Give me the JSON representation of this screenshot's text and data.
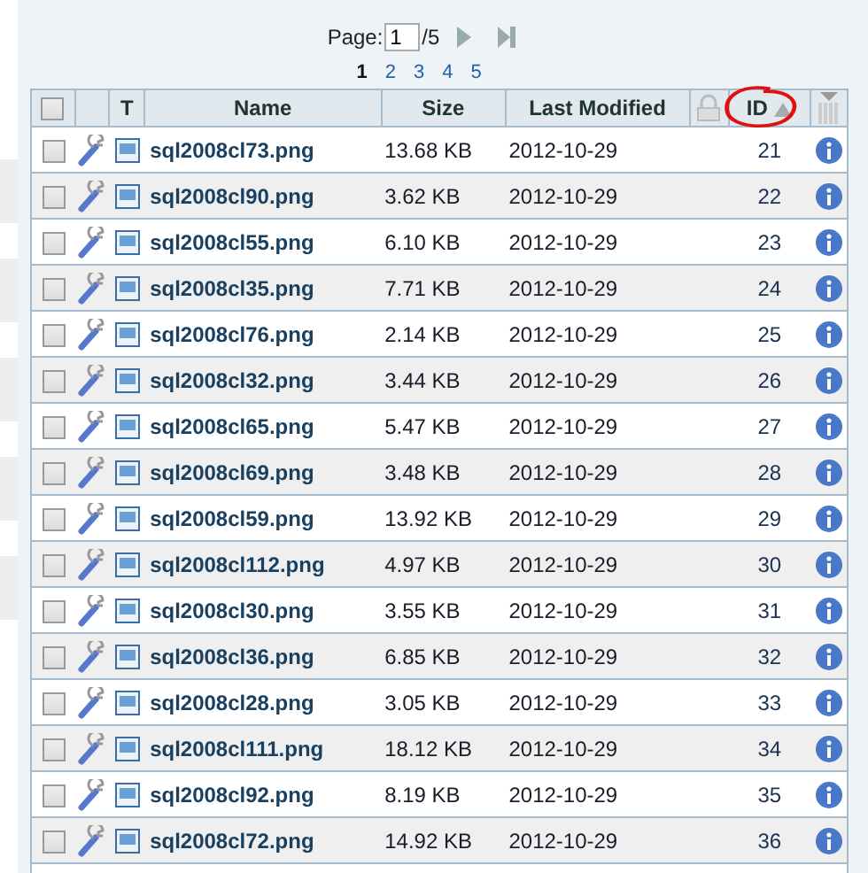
{
  "pager": {
    "label": "Page:",
    "value": "1",
    "total": "/5",
    "pages": [
      {
        "label": "1",
        "selected": true
      },
      {
        "label": "2",
        "selected": false
      },
      {
        "label": "3",
        "selected": false
      },
      {
        "label": "4",
        "selected": false
      },
      {
        "label": "5",
        "selected": false
      }
    ]
  },
  "table": {
    "select_all_checked": false,
    "columns": [
      {
        "label": "T",
        "sorted": false
      },
      {
        "label": "Name",
        "sorted": false
      },
      {
        "label": "Size",
        "sorted": false
      },
      {
        "label": "Last Modified",
        "sorted": false
      },
      {
        "label": "ID",
        "sorted": true
      }
    ],
    "rows": [
      {
        "name": "sql2008cl73.png",
        "size": "13.68 KB",
        "modified": "2012-10-29",
        "id": "21",
        "checked": false
      },
      {
        "name": "sql2008cl90.png",
        "size": "3.62 KB",
        "modified": "2012-10-29",
        "id": "22",
        "checked": false
      },
      {
        "name": "sql2008cl55.png",
        "size": "6.10 KB",
        "modified": "2012-10-29",
        "id": "23",
        "checked": false
      },
      {
        "name": "sql2008cl35.png",
        "size": "7.71 KB",
        "modified": "2012-10-29",
        "id": "24",
        "checked": false
      },
      {
        "name": "sql2008cl76.png",
        "size": "2.14 KB",
        "modified": "2012-10-29",
        "id": "25",
        "checked": false
      },
      {
        "name": "sql2008cl32.png",
        "size": "3.44 KB",
        "modified": "2012-10-29",
        "id": "26",
        "checked": false
      },
      {
        "name": "sql2008cl65.png",
        "size": "5.47 KB",
        "modified": "2012-10-29",
        "id": "27",
        "checked": false
      },
      {
        "name": "sql2008cl69.png",
        "size": "3.48 KB",
        "modified": "2012-10-29",
        "id": "28",
        "checked": false
      },
      {
        "name": "sql2008cl59.png",
        "size": "13.92 KB",
        "modified": "2012-10-29",
        "id": "29",
        "checked": false
      },
      {
        "name": "sql2008cl112.png",
        "size": "4.97 KB",
        "modified": "2012-10-29",
        "id": "30",
        "checked": false
      },
      {
        "name": "sql2008cl30.png",
        "size": "3.55 KB",
        "modified": "2012-10-29",
        "id": "31",
        "checked": false
      },
      {
        "name": "sql2008cl36.png",
        "size": "6.85 KB",
        "modified": "2012-10-29",
        "id": "32",
        "checked": false
      },
      {
        "name": "sql2008cl28.png",
        "size": "3.05 KB",
        "modified": "2012-10-29",
        "id": "33",
        "checked": false
      },
      {
        "name": "sql2008cl111.png",
        "size": "18.12 KB",
        "modified": "2012-10-29",
        "id": "34",
        "checked": false
      },
      {
        "name": "sql2008cl92.png",
        "size": "8.19 KB",
        "modified": "2012-10-29",
        "id": "35",
        "checked": false
      },
      {
        "name": "sql2008cl72.png",
        "size": "14.92 KB",
        "modified": "2012-10-29",
        "id": "36",
        "checked": false
      }
    ]
  }
}
